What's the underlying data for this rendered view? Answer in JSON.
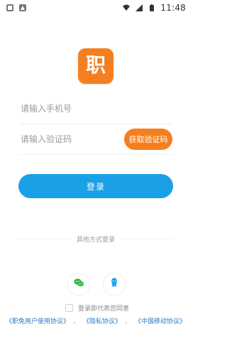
{
  "status_bar": {
    "time": "11:48",
    "icons_left": [
      "notification-icon",
      "app-icon"
    ],
    "icons_right": [
      "wifi-icon",
      "cellular-icon",
      "battery-icon"
    ]
  },
  "app": {
    "logo_text": "职",
    "brand_color": "#f57f1f",
    "accent_blue": "#1aa0e7"
  },
  "form": {
    "phone_placeholder": "请输入手机号",
    "code_placeholder": "请输入验证码",
    "get_code_label": "获取验证码",
    "login_label": "登录"
  },
  "alt_login": {
    "label": "其他方式登录",
    "methods": [
      {
        "name": "wechat",
        "icon": "wechat-icon"
      },
      {
        "name": "qq",
        "icon": "qq-icon"
      }
    ]
  },
  "agreement": {
    "label": "登录即代表您同意",
    "links": [
      "《职免用户使用协议》",
      "《隐私协议》",
      "《中国移动协议》"
    ],
    "separator": "、"
  }
}
